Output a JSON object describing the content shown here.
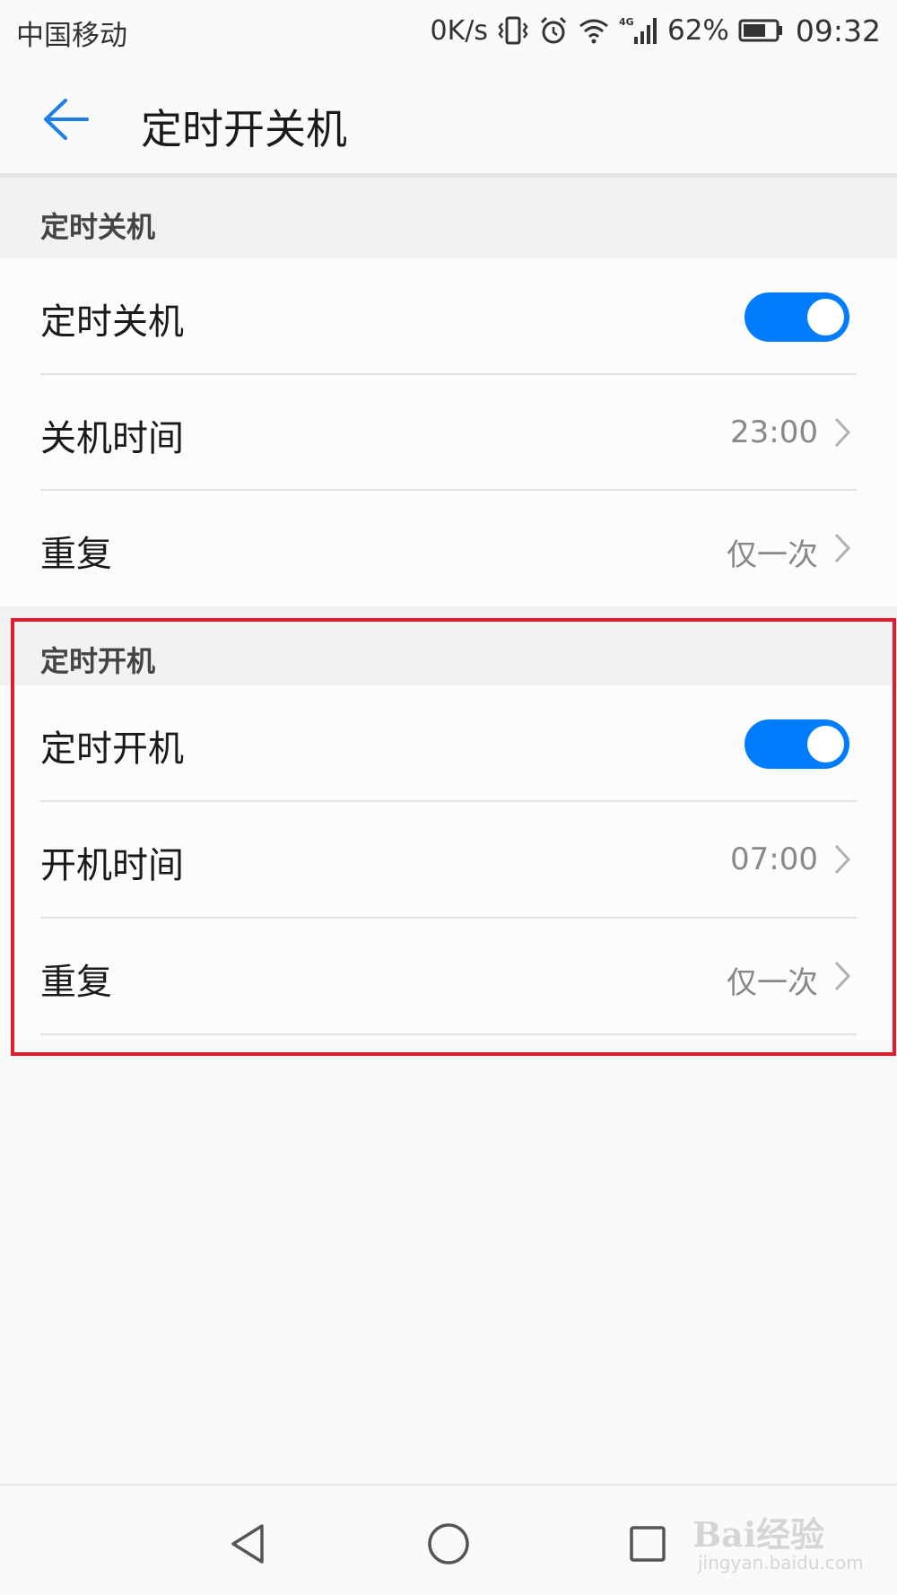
{
  "status_bar": {
    "carrier": "中国移动",
    "net_speed": "0K/s",
    "network_type": "4G",
    "battery": "62%",
    "time": "09:32",
    "icons": [
      "vibrate-icon",
      "alarm-icon",
      "wifi-icon",
      "signal-icon",
      "battery-icon"
    ]
  },
  "app_bar": {
    "title": "定时开关机",
    "back_icon": "back-arrow-icon"
  },
  "shutdown_section": {
    "header": "定时关机",
    "toggle_label": "定时关机",
    "toggle_on": true,
    "time_label": "关机时间",
    "time_value": "23:00",
    "repeat_label": "重复",
    "repeat_value": "仅一次"
  },
  "startup_section": {
    "header": "定时开机",
    "toggle_label": "定时开机",
    "toggle_on": true,
    "time_label": "开机时间",
    "time_value": "07:00",
    "repeat_label": "重复",
    "repeat_value": "仅一次"
  },
  "nav_bar": {
    "buttons": [
      "back-triangle-icon",
      "home-circle-icon",
      "recents-square-icon"
    ]
  },
  "watermark": {
    "logo_text": "Bai经验",
    "url": "jingyan.baidu.com"
  },
  "colors": {
    "accent": "#007dff",
    "highlight": "#e8192c",
    "background": "#fafafa"
  }
}
